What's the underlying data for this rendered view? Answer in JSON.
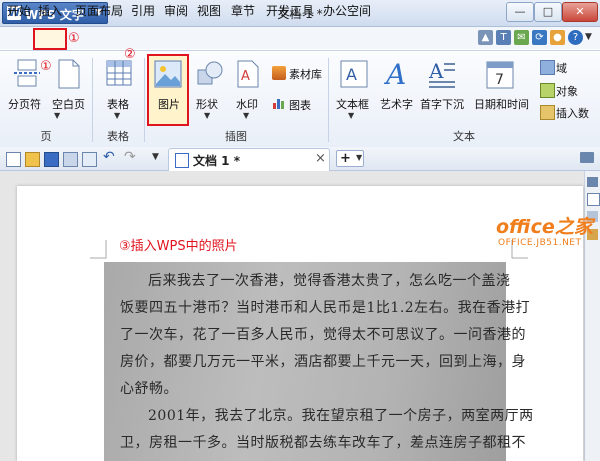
{
  "titlebar": {
    "app_name": "WPS 文字",
    "app_logo": "W",
    "doc_title": "文档 1 *",
    "minimize": "—",
    "maximize": "□",
    "close": "✕"
  },
  "menu": {
    "items": [
      "开始",
      "插入",
      "页面布局",
      "引用",
      "审阅",
      "视图",
      "章节",
      "开发工具",
      "办公空间"
    ],
    "selected": "插入"
  },
  "annotations": {
    "step1": "①",
    "step2": "②",
    "step3": "③插入WPS中的照片"
  },
  "ribbon": {
    "page_break": "分页符",
    "blank_page": "空白页",
    "table": "表格",
    "picture": "图片",
    "shapes": "形状",
    "watermark": "水印",
    "material": "素材库",
    "chart": "图表",
    "textbox": "文本框",
    "wordart": "艺术字",
    "dropcap": "首字下沉",
    "datetime": "日期和时间",
    "field": "域",
    "object": "对象",
    "insert_num": "插入数",
    "groups": {
      "page": "页",
      "table": "表格",
      "illustration": "插图",
      "text": "文本"
    }
  },
  "tabbar": {
    "doc_tab": "文档 1 *",
    "close_tab": "×",
    "new_tab": "+"
  },
  "watermark_logo": {
    "brand": "office之家",
    "url": "OFFICE.JB51.NET"
  },
  "photo_text": [
    "后来我去了一次香港，觉得香港太贵了，怎么吃一个盖浇",
    "饭要四五十港币？当时港币和人民币是1比1.2左右。我在香港打",
    "了一次车，花了一百多人民币，觉得太不可思议了。一问香港的",
    "房价，都要几万元一平米，酒店都要上千元一天，回到上海，身",
    "心舒畅。",
    "2001年，我去了北京。我在望京租了一个房子，两室两厅两",
    "卫，房租一千多。当时版税都去练车改车了，差点连房子都租不"
  ],
  "colors": {
    "accent": "#e0141e",
    "brand_orange": "#f07e1c"
  }
}
